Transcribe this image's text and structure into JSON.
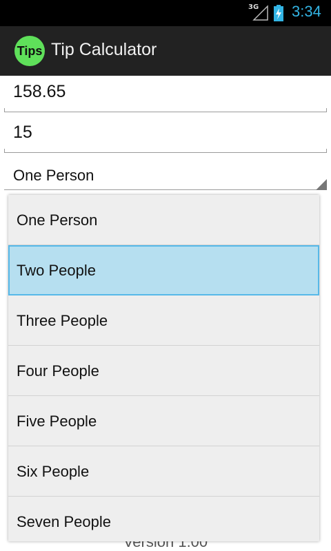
{
  "status_bar": {
    "network": "3G",
    "time": "3:34",
    "accent_color": "#33b5e5"
  },
  "action_bar": {
    "icon_text": "Tips",
    "title": "Tip Calculator"
  },
  "form": {
    "bill_amount": "158.65",
    "tip_percent": "15",
    "split_selected": "One Person"
  },
  "dropdown": {
    "options": [
      {
        "label": "One Person",
        "state": "normal"
      },
      {
        "label": "Two People",
        "state": "highlighted"
      },
      {
        "label": "Three People",
        "state": "normal"
      },
      {
        "label": "Four People",
        "state": "normal"
      },
      {
        "label": "Five People",
        "state": "normal"
      },
      {
        "label": "Six People",
        "state": "normal"
      },
      {
        "label": "Seven People",
        "state": "normal"
      }
    ]
  },
  "footer": {
    "version": "Version 1.00"
  }
}
